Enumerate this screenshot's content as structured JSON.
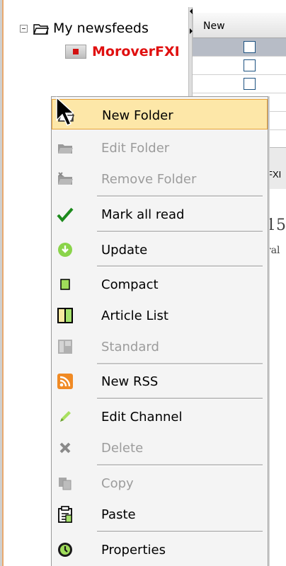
{
  "tree": {
    "root_label": "My newsfeeds",
    "feed_label": "MoroverFXI"
  },
  "table": {
    "header_new": "New",
    "tab_text": "FXI",
    "preview_number": "15",
    "preview_snippet": "ral"
  },
  "context_menu": {
    "items": [
      {
        "label": "New Folder",
        "icon": "new-folder-icon",
        "enabled": true,
        "highlighted": true
      },
      {
        "label": "Edit Folder",
        "icon": "edit-folder-icon",
        "enabled": false
      },
      {
        "label": "Remove Folder",
        "icon": "remove-folder-icon",
        "enabled": false
      },
      {
        "label": "Mark all read",
        "icon": "checkmark-icon",
        "enabled": true
      },
      {
        "label": "Update",
        "icon": "update-icon",
        "enabled": true
      },
      {
        "label": "Compact",
        "icon": "compact-icon",
        "enabled": true
      },
      {
        "label": "Article List",
        "icon": "article-list-icon",
        "enabled": true
      },
      {
        "label": "Standard",
        "icon": "standard-icon",
        "enabled": false
      },
      {
        "label": "New RSS",
        "icon": "rss-icon",
        "enabled": true
      },
      {
        "label": "Edit Channel",
        "icon": "edit-channel-icon",
        "enabled": true
      },
      {
        "label": "Delete",
        "icon": "delete-icon",
        "enabled": false
      },
      {
        "label": "Copy",
        "icon": "copy-icon",
        "enabled": false
      },
      {
        "label": "Paste",
        "icon": "paste-icon",
        "enabled": true
      },
      {
        "label": "Properties",
        "icon": "properties-icon",
        "enabled": true
      }
    ]
  },
  "colors": {
    "feed_unread": "#e01010",
    "menu_highlight": "#fde7a8",
    "menu_highlight_border": "#e7a23a",
    "disabled_text": "#9c9c9c"
  }
}
